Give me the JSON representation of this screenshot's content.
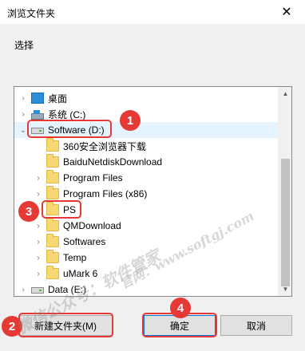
{
  "window": {
    "title": "浏览文件夹",
    "close_symbol": "✕"
  },
  "prompt": "选择",
  "tree": {
    "items": [
      {
        "label": "桌面",
        "icon": "desktop-icon",
        "expand": "›"
      },
      {
        "label": "系统 (C:)",
        "icon": "system-drive-icon",
        "expand": "›"
      },
      {
        "label": "Software (D:)",
        "icon": "drive-icon",
        "expand": "⌄"
      },
      {
        "label": "360安全浏览器下载",
        "icon": "folder-icon",
        "expand": ""
      },
      {
        "label": "BaiduNetdiskDownload",
        "icon": "folder-icon",
        "expand": ""
      },
      {
        "label": "Program Files",
        "icon": "folder-icon",
        "expand": "›"
      },
      {
        "label": "Program Files (x86)",
        "icon": "folder-icon",
        "expand": "›"
      },
      {
        "label": "PS",
        "icon": "folder-icon",
        "expand": ""
      },
      {
        "label": "QMDownload",
        "icon": "folder-icon",
        "expand": "›"
      },
      {
        "label": "Softwares",
        "icon": "folder-icon",
        "expand": "›"
      },
      {
        "label": "Temp",
        "icon": "folder-icon",
        "expand": "›"
      },
      {
        "label": "uMark 6",
        "icon": "folder-icon",
        "expand": "›"
      },
      {
        "label": "Data (E:)",
        "icon": "drive-icon",
        "expand": "›"
      }
    ]
  },
  "buttons": {
    "new_folder": "新建文件夹(M)",
    "ok": "确定",
    "cancel": "取消"
  },
  "markers": {
    "one": "1",
    "two": "2",
    "three": "3",
    "four": "4"
  },
  "watermark": {
    "line1": "微信公众号：软件管家",
    "line2": "官网：www.softgj.com"
  },
  "colors": {
    "marker_red": "#e53935",
    "folder_yellow": "#f8d775",
    "selection": "#e5f3ff",
    "default_button_border": "#0078d7"
  }
}
